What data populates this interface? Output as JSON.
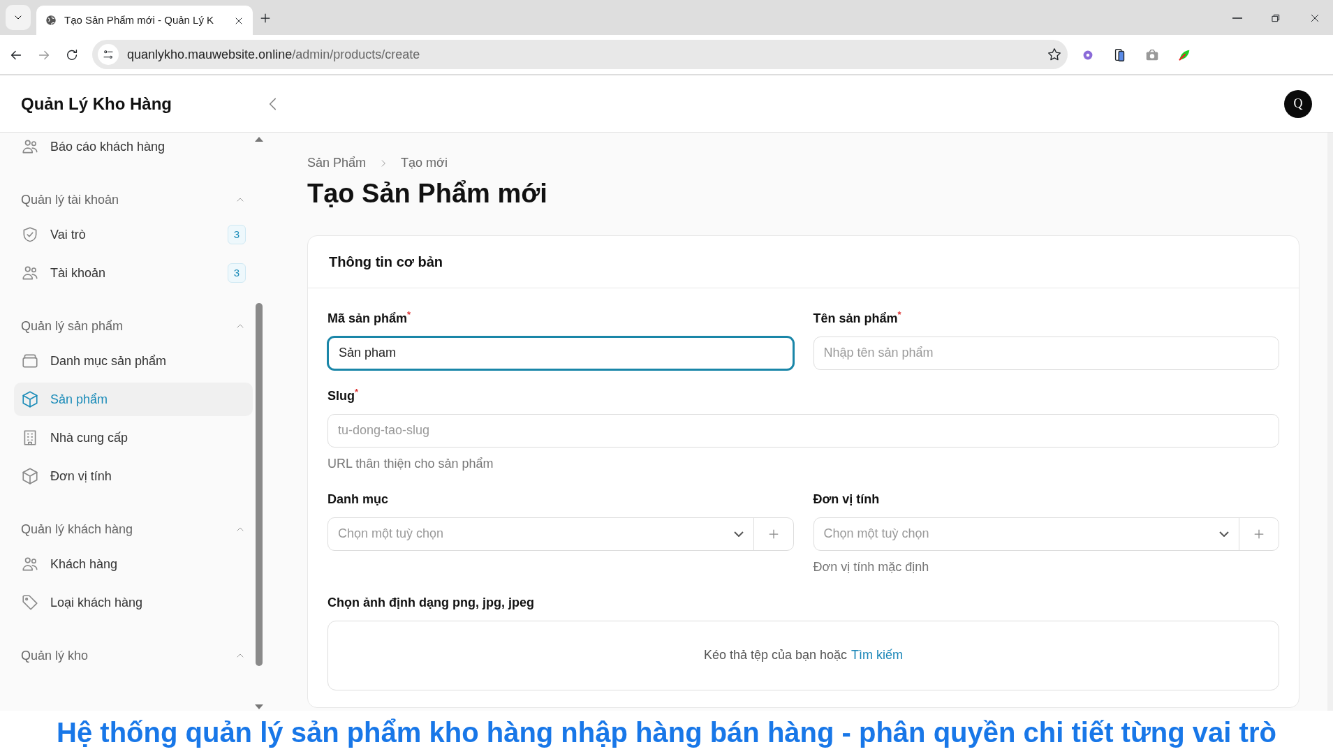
{
  "browser": {
    "tab_title": "Tạo Sản Phẩm mới - Quản Lý K",
    "url_host": "quanlykho.mauwebsite.online",
    "url_path": "/admin/products/create"
  },
  "app": {
    "brand": "Quản Lý Kho Hàng",
    "avatar": "Q"
  },
  "sidebar": {
    "items": [
      {
        "label": "Báo cáo khách hàng",
        "kind": "users",
        "selected": false
      }
    ],
    "groups": [
      {
        "label": "Quản lý tài khoản",
        "expanded": true,
        "items": [
          {
            "label": "Vai trò",
            "kind": "shield",
            "badge": "3",
            "selected": false
          },
          {
            "label": "Tài khoản",
            "kind": "users",
            "badge": "3",
            "selected": false
          }
        ]
      },
      {
        "label": "Quản lý sản phẩm",
        "expanded": true,
        "items": [
          {
            "label": "Danh mục sản phẩm",
            "kind": "stack",
            "selected": false
          },
          {
            "label": "Sản phẩm",
            "kind": "cube",
            "selected": true
          },
          {
            "label": "Nhà cung cấp",
            "kind": "building",
            "selected": false
          },
          {
            "label": "Đơn vị tính",
            "kind": "cube",
            "selected": false
          }
        ]
      },
      {
        "label": "Quản lý khách hàng",
        "expanded": true,
        "items": [
          {
            "label": "Khách hàng",
            "kind": "users",
            "selected": false
          },
          {
            "label": "Loại khách hàng",
            "kind": "tag",
            "selected": false
          }
        ]
      },
      {
        "label": "Quản lý kho",
        "expanded": true
      }
    ]
  },
  "breadcrumb": [
    "Sản Phẩm",
    "Tạo mới"
  ],
  "page_title": "Tạo Sản Phẩm mới",
  "section": {
    "title": "Thông tin cơ bản",
    "rows": [
      [
        {
          "kind": "text",
          "label": "Mã sản phẩm$^{*}$",
          "value": "Sản pham",
          "focused": true
        },
        {
          "kind": "text",
          "label": "Tên sản phẩm$^{*}$",
          "placeholder": "Nhập tên sản phẩm",
          "focused": false
        }
      ],
      [
        {
          "kind": "text",
          "label": "Slug$^{*}$",
          "placeholder": "tu-dong-tao-slug",
          "hint": "URL thân thiện cho sản phẩm",
          "focused": false
        }
      ],
      [
        {
          "kind": "select",
          "label": "Danh mục",
          "placeholder": "Chọn một tuỳ chọn"
        },
        {
          "kind": "select",
          "label": "Đơn vị tính",
          "placeholder": "Chọn một tuỳ chọn",
          "hint": "Đơn vị tính mặc định"
        }
      ],
      [
        {
          "kind": "upload",
          "label": "Chọn ảnh định dạng png, jpg, jpeg",
          "prompt": "Kéo thả tệp của bạn hoặc",
          "link": "Tìm kiếm"
        }
      ]
    ]
  },
  "video_caption": "Hệ thống quản lý sản phẩm kho hàng nhập hàng bán hàng - phân quyền chi tiết từng vai trò"
}
